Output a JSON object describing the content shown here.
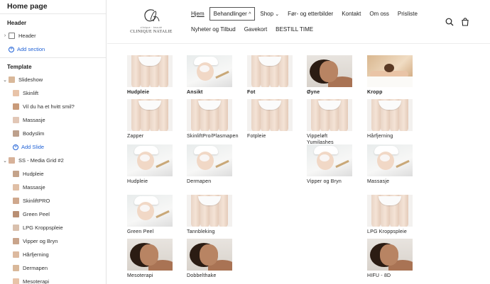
{
  "sidebar": {
    "title": "Home page",
    "sections": [
      {
        "name": "Header",
        "blocks": [
          {
            "label": "Header",
            "kind": "section",
            "caret": "›"
          }
        ],
        "add_label": "Add section"
      },
      {
        "name": "Template",
        "blocks": [
          {
            "label": "Slideshow",
            "kind": "section",
            "caret": "⌄"
          },
          {
            "label": "Skinlift",
            "kind": "child"
          },
          {
            "label": "Vil du ha et hvitt smil?",
            "kind": "child"
          },
          {
            "label": "Massasje",
            "kind": "child"
          },
          {
            "label": "Bodyslim",
            "kind": "child"
          },
          {
            "label": "Add Slide",
            "kind": "add"
          },
          {
            "label": "SS - Media Grid #2",
            "kind": "section",
            "caret": "⌄"
          },
          {
            "label": "Hudpleie",
            "kind": "child"
          },
          {
            "label": "Massasje",
            "kind": "child"
          },
          {
            "label": "SkinliftPRO",
            "kind": "child"
          },
          {
            "label": "Green Peel",
            "kind": "child"
          },
          {
            "label": "LPG Kroppspleie",
            "kind": "child"
          },
          {
            "label": "Vipper og Bryn",
            "kind": "child"
          },
          {
            "label": "Hårfjerning",
            "kind": "child"
          },
          {
            "label": "Dermapen",
            "kind": "child"
          },
          {
            "label": "Mesoterapi",
            "kind": "child"
          }
        ]
      }
    ]
  },
  "site": {
    "logo": {
      "small_text": "clinique · beauté",
      "brand": "CLINIQUE NATALIE"
    },
    "nav_row1": [
      {
        "label": "Hjem",
        "state": "current"
      },
      {
        "label": "Behandlinger",
        "state": "open",
        "caret": "^"
      },
      {
        "label": "Shop",
        "caret": "⌄"
      },
      {
        "label": "Før- og etterbilder"
      },
      {
        "label": "Kontakt"
      },
      {
        "label": "Om oss"
      },
      {
        "label": "Prisliste"
      }
    ],
    "nav_row2": [
      {
        "label": "Nyheter og Tilbud"
      },
      {
        "label": "Gavekort"
      },
      {
        "label": "BESTILL TIME"
      }
    ],
    "icons": {
      "search": "search-icon",
      "cart": "cart-icon"
    }
  },
  "grid": {
    "columns": [
      [
        {
          "caption": "Hudpleie",
          "bold": true,
          "image": "legs"
        },
        {
          "caption": "Zapper",
          "image": "legs"
        },
        {
          "caption": "Hudpleie",
          "image": "spa"
        },
        {
          "caption": "Green Peel",
          "image": "spa"
        },
        {
          "caption": "Mesoterapi",
          "image": "woman"
        }
      ],
      [
        {
          "caption": "Ansikt",
          "bold": true,
          "image": "spa"
        },
        {
          "caption": "SkinliftPro/Plasmapen",
          "image": "legs"
        },
        {
          "caption": "Dermapen",
          "image": "spa"
        },
        {
          "caption": "Tannbleking",
          "image": "legs"
        },
        {
          "caption": "Dobbelthake",
          "image": "woman"
        }
      ],
      [
        {
          "caption": "Fot",
          "bold": true,
          "image": "legs"
        },
        {
          "caption": "Fotpleie",
          "image": "legs"
        }
      ],
      [
        {
          "caption": "Øyne",
          "bold": true,
          "image": "woman"
        },
        {
          "caption": "Vippeløft Yumilashes",
          "image": "legs"
        },
        {
          "caption": "Vipper og Bryn",
          "image": "spa"
        }
      ],
      [
        {
          "caption": "Kropp",
          "bold": true,
          "image": "massage"
        },
        {
          "caption": "Hårfjerning",
          "image": "legs"
        },
        {
          "caption": "Massasje",
          "image": "spa"
        },
        {
          "caption": "LPG Kroppspleie",
          "image": "legs"
        },
        {
          "caption": "HIFU - 8D",
          "image": "woman"
        }
      ]
    ]
  },
  "colors": {
    "accent": "#1f61d6",
    "text": "#1f1f1f",
    "border": "#e3e3e3"
  }
}
